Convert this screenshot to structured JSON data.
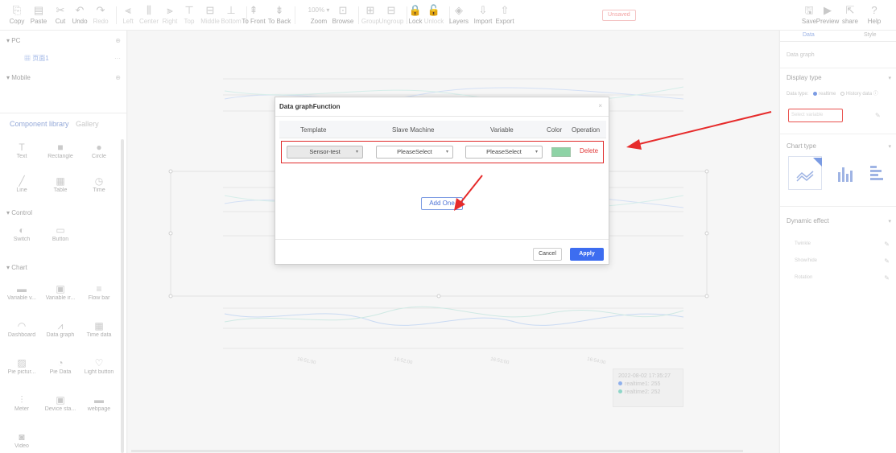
{
  "toolbar": {
    "items": [
      {
        "icon": "copy-icon",
        "glyph": "⎘",
        "label": "Copy"
      },
      {
        "icon": "paste-icon",
        "glyph": "▤",
        "label": "Paste"
      },
      {
        "icon": "cut-icon",
        "glyph": "✂",
        "label": "Cut"
      },
      {
        "icon": "undo-icon",
        "glyph": "↶",
        "label": "Undo"
      },
      {
        "icon": "redo-icon",
        "glyph": "↷",
        "label": "Redo"
      },
      {
        "icon": "align-left-icon",
        "glyph": "⫷",
        "label": "Left"
      },
      {
        "icon": "align-center-icon",
        "glyph": "⫼",
        "label": "Center"
      },
      {
        "icon": "align-right-icon",
        "glyph": "⫸",
        "label": "Right"
      },
      {
        "icon": "align-top-icon",
        "glyph": "⊤",
        "label": "Top"
      },
      {
        "icon": "align-middle-icon",
        "glyph": "⊟",
        "label": "Middle"
      },
      {
        "icon": "align-bottom-icon",
        "glyph": "⊥",
        "label": "Bottom"
      },
      {
        "icon": "to-front-icon",
        "glyph": "⇞",
        "label": "To Front"
      },
      {
        "icon": "to-back-icon",
        "glyph": "⇟",
        "label": "To Back"
      },
      {
        "icon": "zoom-icon",
        "glyph": "100% ▾",
        "label": "Zoom"
      },
      {
        "icon": "browse-icon",
        "glyph": "⊡",
        "label": "Browse"
      },
      {
        "icon": "group-icon",
        "glyph": "⊞",
        "label": "Group"
      },
      {
        "icon": "ungroup-icon",
        "glyph": "⊟",
        "label": "Ungroup"
      },
      {
        "icon": "lock-icon",
        "glyph": "🔒",
        "label": "Lock"
      },
      {
        "icon": "unlock-icon",
        "glyph": "🔓",
        "label": "Unlock"
      },
      {
        "icon": "layers-icon",
        "glyph": "◈",
        "label": "Layers"
      },
      {
        "icon": "import-icon",
        "glyph": "⇩",
        "label": "Import"
      },
      {
        "icon": "export-icon",
        "glyph": "⇧",
        "label": "Export"
      }
    ],
    "unsaved_label": "Unsaved",
    "right_items": [
      {
        "icon": "save-icon",
        "glyph": "🖫",
        "label": "Save"
      },
      {
        "icon": "preview-icon",
        "glyph": "▶",
        "label": "Preview"
      },
      {
        "icon": "share-icon",
        "glyph": "⇱",
        "label": "share"
      },
      {
        "icon": "help-icon",
        "glyph": "?",
        "label": "Help"
      }
    ]
  },
  "left_panel": {
    "pc_label": "PC",
    "page_item": "页面1",
    "mobile_label": "Mobile",
    "tabs": [
      {
        "label": "Component library",
        "active": true
      },
      {
        "label": "Gallery",
        "active": false
      }
    ],
    "sections": {
      "basic": [
        {
          "icon": "text-icon",
          "glyph": "T",
          "label": "Text"
        },
        {
          "icon": "rectangle-icon",
          "glyph": "■",
          "label": "Rectangle"
        },
        {
          "icon": "circle-icon",
          "glyph": "●",
          "label": "Circle"
        },
        {
          "icon": "line-icon",
          "glyph": "╱",
          "label": "Line"
        },
        {
          "icon": "table-icon",
          "glyph": "▦",
          "label": "Table"
        },
        {
          "icon": "time-icon",
          "glyph": "◷",
          "label": "Time"
        }
      ],
      "control_title": "Control",
      "control": [
        {
          "icon": "switch-icon",
          "glyph": "◐",
          "label": "Switch"
        },
        {
          "icon": "button-icon",
          "glyph": "▭",
          "label": "Button"
        }
      ],
      "chart_title": "Chart",
      "chart": [
        {
          "icon": "variable-value-icon",
          "glyph": "▬",
          "label": "Variable v..."
        },
        {
          "icon": "variable-image-icon",
          "glyph": "▣",
          "label": "Variable ir..."
        },
        {
          "icon": "flow-bar-icon",
          "glyph": "≡",
          "label": "Flow bar"
        },
        {
          "icon": "dashboard-icon",
          "glyph": "◠",
          "label": "Dashboard"
        },
        {
          "icon": "data-graph-icon",
          "glyph": "⩘",
          "label": "Data graph"
        },
        {
          "icon": "time-data-icon",
          "glyph": "▦",
          "label": "Time data"
        },
        {
          "icon": "pie-picture-icon",
          "glyph": "▨",
          "label": "Pie pictur..."
        },
        {
          "icon": "pie-data-icon",
          "glyph": "◔",
          "label": "Pie Data"
        },
        {
          "icon": "light-button-icon",
          "glyph": "♡",
          "label": "Light button"
        },
        {
          "icon": "meter-icon",
          "glyph": "⫶",
          "label": "Meter"
        },
        {
          "icon": "device-status-icon",
          "glyph": "▣",
          "label": "Device sta..."
        },
        {
          "icon": "webpage-icon",
          "glyph": "▬",
          "label": "webpage"
        },
        {
          "icon": "video-icon",
          "glyph": "◙",
          "label": "Video"
        }
      ]
    }
  },
  "canvas": {
    "tooltip": {
      "time": "2022-08-02 17:35:27",
      "series": [
        {
          "name": "realtime1",
          "value": "255",
          "color": "#8fb0ec"
        },
        {
          "name": "realtime2",
          "value": "252",
          "color": "#8fd6c8"
        }
      ]
    },
    "x_labels": [
      "16:51:00",
      "16:52:00",
      "16:53:00",
      "16:54:00"
    ]
  },
  "modal": {
    "title": "Data graphFunction",
    "close": "×",
    "headers": {
      "template": "Template",
      "slave": "Slave Machine",
      "variable": "Variable",
      "color": "Color",
      "operation": "Operation"
    },
    "row": {
      "template_value": "Sensor-test",
      "slave_value": "PleaseSelect",
      "variable_value": "PleaseSelect",
      "color": "#8ed3a6",
      "delete_label": "Delete"
    },
    "add_label": "Add One",
    "cancel_label": "Cancel",
    "apply_label": "Apply"
  },
  "right_panel": {
    "tabs": [
      "Data",
      "Style"
    ],
    "component_name": "Data graph",
    "display_type_title": "Display type",
    "data_type_label": "Data type:",
    "option_realtime": "realtime",
    "option_history": "History data",
    "select_variable_placeholder": "Select variable",
    "chart_type_title": "Chart type",
    "dynamic_effect_title": "Dynamic effect",
    "effects": [
      "Twinkle",
      "Show/hide",
      "Rotation"
    ]
  },
  "colors": {
    "accent": "#3d6df0",
    "danger": "#e23b3b",
    "highlight": "#e02b2b"
  }
}
